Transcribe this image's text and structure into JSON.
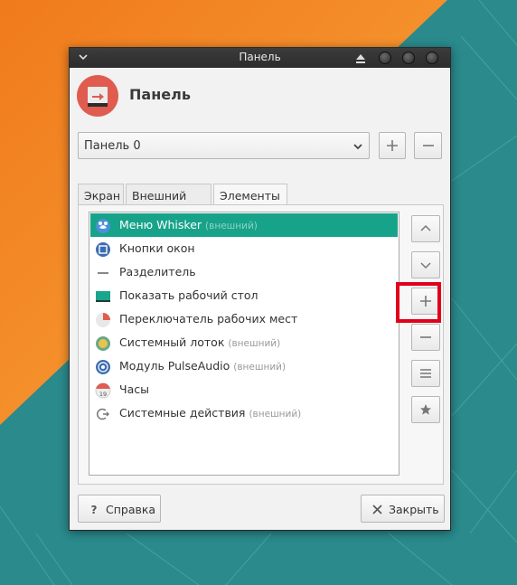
{
  "window": {
    "title": "Панель",
    "header_title": "Панель"
  },
  "panel_select": {
    "value": "Панель 0"
  },
  "tabs": [
    {
      "label": "Экран"
    },
    {
      "label": "Внешний вид"
    },
    {
      "label": "Элементы"
    }
  ],
  "items": [
    {
      "label": "Меню Whisker",
      "ext": "(внешний)",
      "icon": "whisker-menu-icon",
      "selected": true
    },
    {
      "label": "Кнопки окон",
      "ext": "",
      "icon": "window-buttons-icon"
    },
    {
      "label": "Разделитель",
      "ext": "",
      "icon": "separator-icon"
    },
    {
      "label": "Показать рабочий стол",
      "ext": "",
      "icon": "show-desktop-icon"
    },
    {
      "label": "Переключатель рабочих мест",
      "ext": "",
      "icon": "workspace-switcher-icon"
    },
    {
      "label": "Системный лоток",
      "ext": "(внешний)",
      "icon": "system-tray-icon"
    },
    {
      "label": "Модуль PulseAudio",
      "ext": "(внешний)",
      "icon": "pulseaudio-icon"
    },
    {
      "label": "Часы",
      "ext": "",
      "icon": "clock-icon"
    },
    {
      "label": "Системные действия",
      "ext": "(внешний)",
      "icon": "system-actions-icon"
    }
  ],
  "clock_icon_day": "19",
  "buttons": {
    "help": "Справка",
    "close": "Закрыть"
  },
  "colors": {
    "selection": "#17a38a",
    "highlight_box": "#e0001b",
    "header_icon": "#e05c4f"
  }
}
